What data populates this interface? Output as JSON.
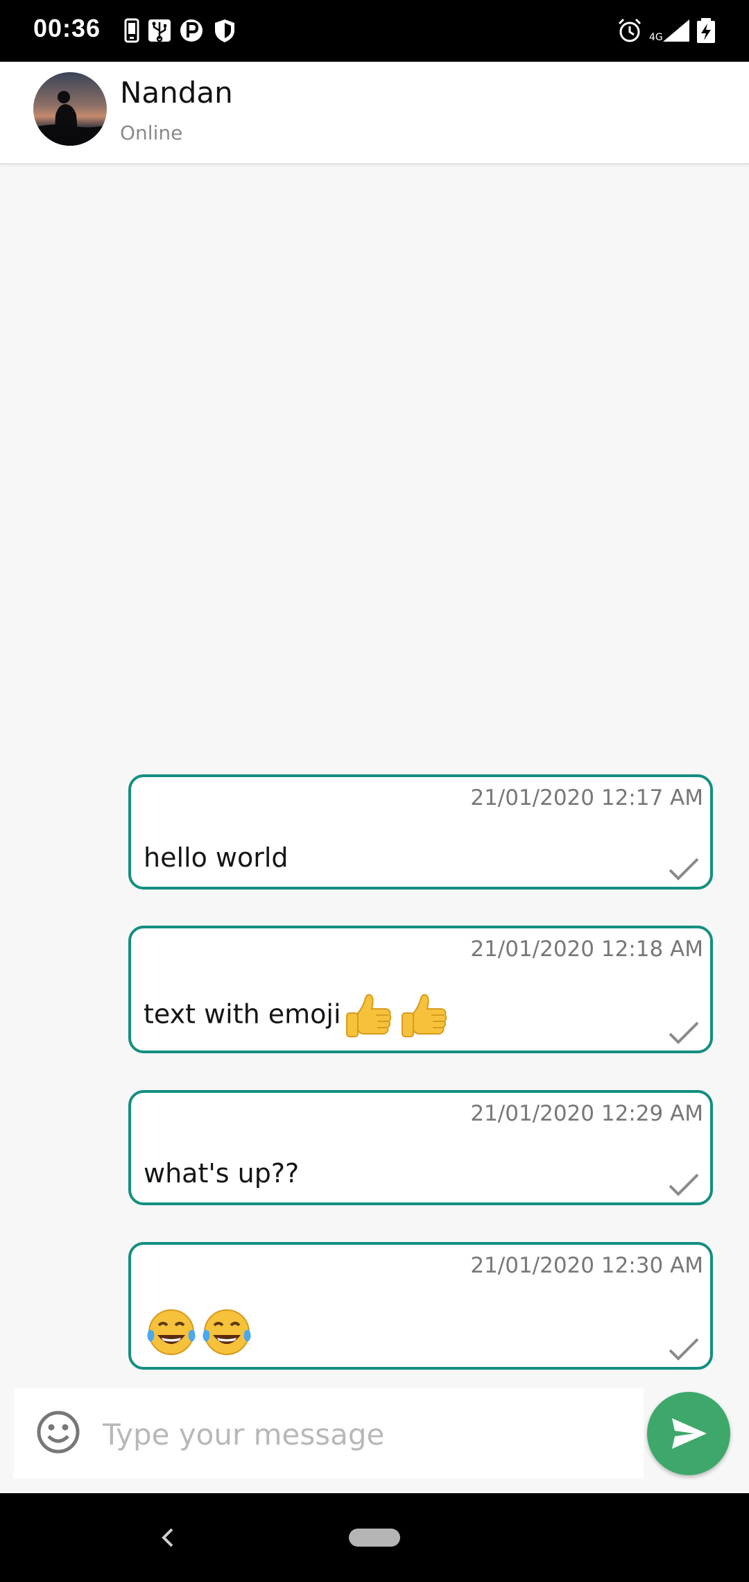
{
  "status_bar": {
    "time": "00:36",
    "left_icons": [
      "phone-icon",
      "usb-icon",
      "parking-icon",
      "shield-icon"
    ],
    "right_icons": [
      "alarm-icon",
      "signal-4g-icon",
      "battery-charging-icon"
    ],
    "network_label": "4G"
  },
  "header": {
    "contact_name": "Nandan",
    "contact_status": "Online"
  },
  "messages": [
    {
      "timestamp": "21/01/2020 12:17 AM",
      "text": "hello world",
      "emojis": [],
      "status": "sent"
    },
    {
      "timestamp": "21/01/2020 12:18 AM",
      "text": "text with emoji",
      "emojis": [
        "thumbs-up",
        "thumbs-up"
      ],
      "status": "sent"
    },
    {
      "timestamp": "21/01/2020 12:29 AM",
      "text": "what's up??",
      "emojis": [],
      "status": "sent"
    },
    {
      "timestamp": "21/01/2020 12:30 AM",
      "text": "",
      "emojis": [
        "tears-of-joy",
        "tears-of-joy"
      ],
      "status": "sent"
    }
  ],
  "composer": {
    "placeholder": "Type your message",
    "value": ""
  },
  "colors": {
    "bubble_border": "#138f7f",
    "send_button": "#3da86a",
    "background": "#f7f7f7"
  }
}
